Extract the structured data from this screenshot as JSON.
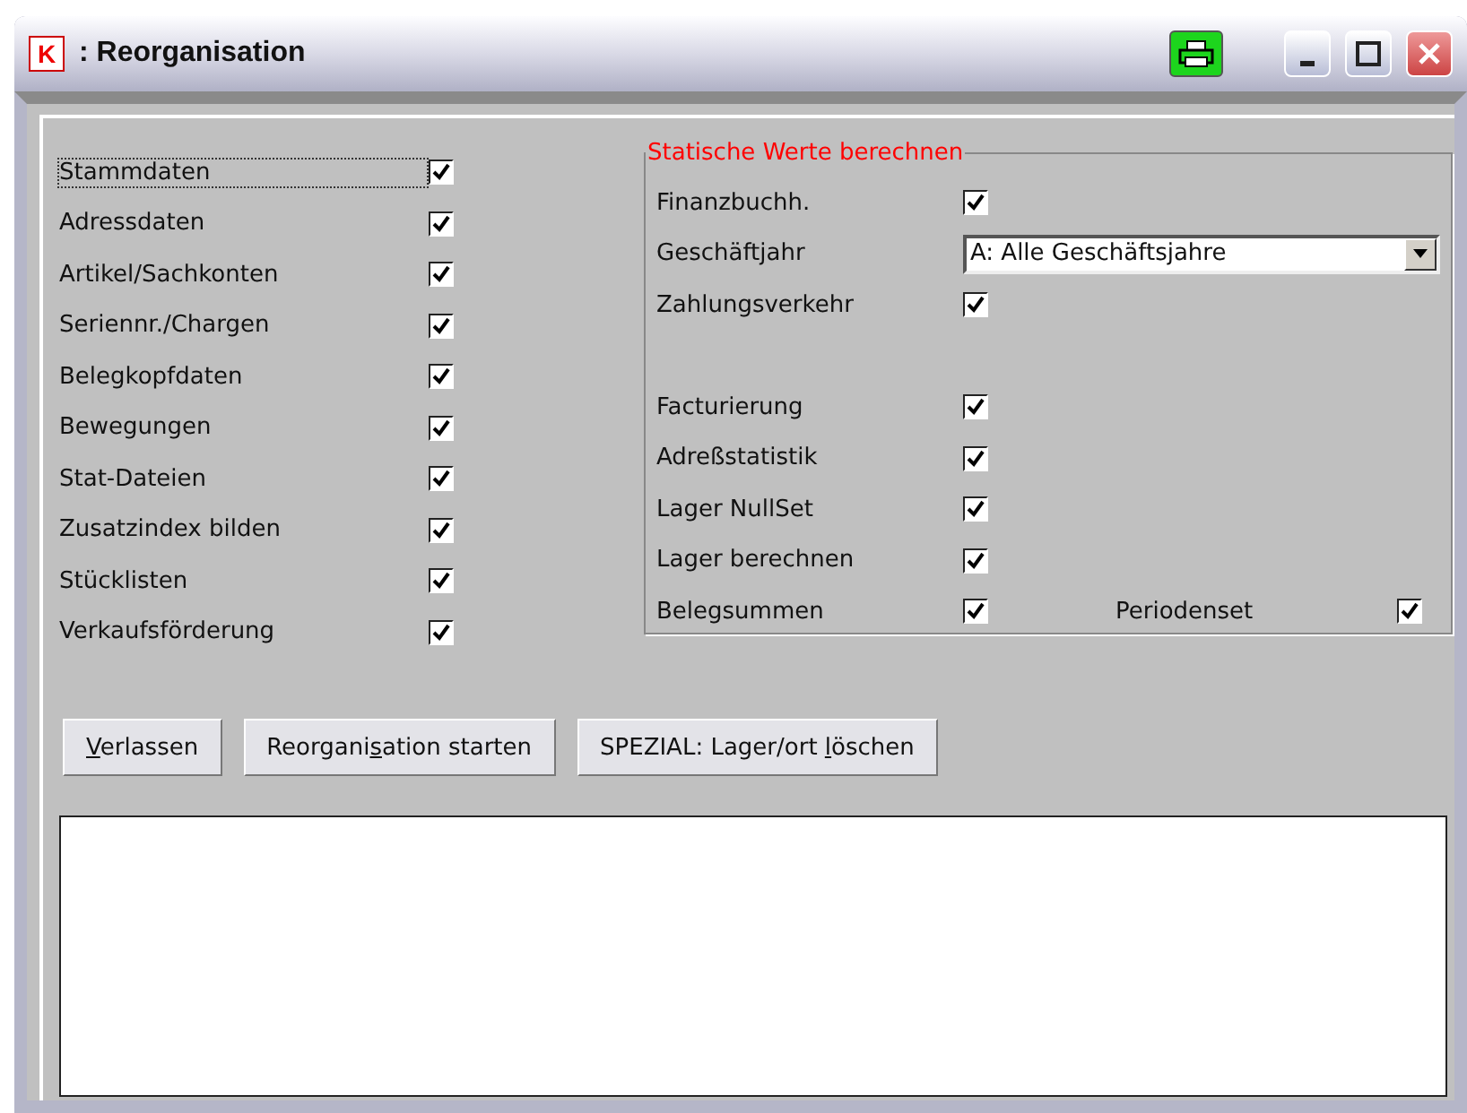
{
  "window": {
    "logo": "K",
    "title": ": Reorganisation"
  },
  "left_items": [
    {
      "label": "Stammdaten",
      "checked": true,
      "focused": true
    },
    {
      "label": "Adressdaten",
      "checked": true,
      "focused": false
    },
    {
      "label": "Artikel/Sachkonten",
      "checked": true,
      "focused": false
    },
    {
      "label": "Seriennr./Chargen",
      "checked": true,
      "focused": false
    },
    {
      "label": "Belegkopfdaten",
      "checked": true,
      "focused": false
    },
    {
      "label": "Bewegungen",
      "checked": true,
      "focused": false
    },
    {
      "label": "Stat-Dateien",
      "checked": true,
      "focused": false
    },
    {
      "label": "Zusatzindex bilden",
      "checked": true,
      "focused": false
    },
    {
      "label": "Stücklisten",
      "checked": true,
      "focused": false
    },
    {
      "label": "Verkaufsförderung",
      "checked": true,
      "focused": false
    }
  ],
  "group": {
    "title": "Statische Werte berechnen",
    "sections": [
      [
        {
          "kind": "checkbox",
          "label": "Finanzbuchh.",
          "checked": true
        },
        {
          "kind": "combo",
          "label": "Geschäftjahr",
          "value": "A: Alle Geschäftsjahre"
        },
        {
          "kind": "checkbox",
          "label": "Zahlungsverkehr",
          "checked": true
        }
      ],
      [
        {
          "kind": "checkbox",
          "label": "Facturierung",
          "checked": true
        },
        {
          "kind": "checkbox",
          "label": "Adreßstatistik",
          "checked": true
        },
        {
          "kind": "checkbox",
          "label": "Lager NullSet",
          "checked": true
        },
        {
          "kind": "checkbox",
          "label": "Lager berechnen",
          "checked": true
        },
        {
          "kind": "checkbox",
          "label": "Belegsummen",
          "checked": true,
          "extra": {
            "label": "Periodenset",
            "checked": true
          }
        }
      ]
    ]
  },
  "buttons": [
    {
      "key": "V",
      "post": "erlassen"
    },
    {
      "pre": "Reorgani",
      "key": "s",
      "post": "ation starten"
    },
    {
      "pre": "SPEZIAL: Lager/ort ",
      "key": "l",
      "post": "öschen"
    }
  ]
}
